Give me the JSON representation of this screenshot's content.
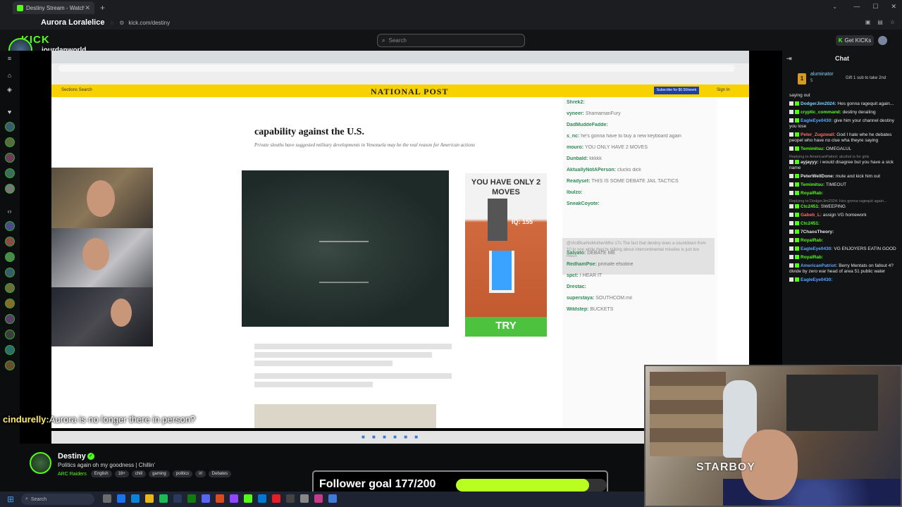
{
  "browser": {
    "tab_title": "Destiny Stream - Watch Liv",
    "profile_name": "Aurora Loralelice",
    "url": "kick.com/destiny"
  },
  "header": {
    "logo": "KICK",
    "search_placeholder": "Search",
    "get_kicks_label": "Get KICKs"
  },
  "overlay": {
    "username": "jourdanworld"
  },
  "stream_content": {
    "site_logo": "NATIONAL POST",
    "nav_left": "Sections    Search",
    "subscribe_label": "Subscribe for $0.50/week",
    "signin_label": "Sign In",
    "headline": "capability against the U.S.",
    "deck": "Private sleuths have suggested military developments in Venezuela may be the real reason for American actions",
    "ad_title": "YOU HAVE ONLY 2 MOVES",
    "ad_iq": "IQ: 155",
    "ad_cta": "TRY",
    "inner_chat_lines": [
      {
        "user": "Shrek2:",
        "text": ""
      },
      {
        "user": "vyneer:",
        "text": "ShamamanFury"
      },
      {
        "user": "DadMuddeFadde:",
        "text": ""
      },
      {
        "user": "s_nc:",
        "text": "he's gonna have to buy a new keyboard again"
      },
      {
        "user": "mouro:",
        "text": "YOU ONLY HAVE 2 MOVES"
      },
      {
        "user": "Dunbald:",
        "text": "kkkkk"
      },
      {
        "user": "AktuallyNotAPerson:",
        "text": "clucks dick"
      },
      {
        "user": "Readyset:",
        "text": "THIS IS SOME DEBATE JAIL TACTICS"
      },
      {
        "user": "lbulzo:",
        "text": ""
      },
      {
        "user": "SneakCoyote:",
        "text": ""
      },
      {
        "user": "Salvato:",
        "text": "DEBATE ME"
      },
      {
        "user": "RedhamPoe:",
        "text": "primafe efsotine"
      },
      {
        "user": "spct:",
        "text": "I HEAR IT"
      },
      {
        "user": "Drestac:",
        "text": ""
      },
      {
        "user": "superstaya:",
        "text": "SOUTHCOM.mil"
      },
      {
        "user": "Wildstep:",
        "text": "BUCKETS"
      }
    ],
    "inner_chat_highlight": "@VictBlueNoMotherWho 17s The fact that destiny does a countdown from 10 to one while they're talking about intercontinental missiles is just too much"
  },
  "subtitle_overlay": {
    "name": "cindurelly:",
    "text": "Aurora is no longer there in person?"
  },
  "chat": {
    "title": "Chat",
    "pinned": {
      "user": "aluminator",
      "count": "5",
      "text": "Gift 1 sub to take 2nd"
    },
    "messages": [
      {
        "user": "",
        "text": "saying out",
        "color": "#cccccc",
        "reply": ""
      },
      {
        "user": "DodgerJim2024:",
        "text": "Hes gonna ragequit again...",
        "color": "#7fd3ff",
        "reply": ""
      },
      {
        "user": "cryptic_command:",
        "text": "destiny derailing",
        "color": "#53fc18",
        "reply": ""
      },
      {
        "user": "EagleEye0430:",
        "text": "give him your channel destiny you lose",
        "color": "#5aa7ff",
        "reply": ""
      },
      {
        "user": "Peter_Zugzwall:",
        "text": "God I hate whe he debates peopel who have no clue wha theyre saying",
        "color": "#ff6b6b",
        "reply": ""
      },
      {
        "user": "Temimitsu:",
        "text": "OMEGALUL",
        "color": "#53fc18",
        "reply": ""
      },
      {
        "user": "ayjayyy:",
        "text": "i would disagree but you have a sick name",
        "color": "#e6e6e6",
        "reply": "Replying to AmericanPatriot: alcohol is for girls"
      },
      {
        "user": "PeterWellDone:",
        "text": "mute and kick him out",
        "color": "#e6e6e6",
        "reply": ""
      },
      {
        "user": "Temimitsu:",
        "text": "TIMEOUT",
        "color": "#53fc18",
        "reply": ""
      },
      {
        "user": "RoyalRab:",
        "text": "",
        "color": "#53fc18",
        "reply": ""
      },
      {
        "user": "Ctc2451:",
        "text": "SWEEPING",
        "color": "#53fc18",
        "reply": "Replying to DodgerJim2024: Hes gonna ragequit again..."
      },
      {
        "user": "Gabeb_L:",
        "text": "assign VG homework",
        "color": "#ff6b6b",
        "reply": ""
      },
      {
        "user": "Ctc2451:",
        "text": "",
        "color": "#53fc18",
        "reply": ""
      },
      {
        "user": "7ChaosTheory:",
        "text": "",
        "color": "#e6e6e6",
        "reply": ""
      },
      {
        "user": "RoyalRab:",
        "text": "",
        "color": "#53fc18",
        "reply": ""
      },
      {
        "user": "EagleEye0430:",
        "text": "VG ENJOYERS EATIN GOOD",
        "color": "#5aa7ff",
        "reply": ""
      },
      {
        "user": "RoyalRab:",
        "text": "",
        "color": "#53fc18",
        "reply": ""
      },
      {
        "user": "AmericanPatriot:",
        "text": "Berry Mentats on fallout 4? divide by zero war head of area 51 public water",
        "color": "#5aa7ff",
        "reply": ""
      },
      {
        "user": "EagleEye0430:",
        "text": "",
        "color": "#5aa7ff",
        "reply": ""
      }
    ]
  },
  "streamer_cam": {
    "shirt_text": "STARBOY"
  },
  "stream_info": {
    "channel_name": "Destiny",
    "stream_title": "Politics again oh my goodness | Chillin'",
    "category": "ARC Raiders",
    "tags": [
      "English",
      "18+",
      "chill",
      "gaming",
      "politics",
      "irl",
      "Debates"
    ]
  },
  "follower_goal": {
    "label": "Follower goal 177/200",
    "current": 177,
    "target": 200
  },
  "taskbar": {
    "search_label": "Search"
  },
  "colors": {
    "kick_green": "#53fc18",
    "goal_fill": "#b8ff21",
    "np_yellow": "#f7d100"
  }
}
